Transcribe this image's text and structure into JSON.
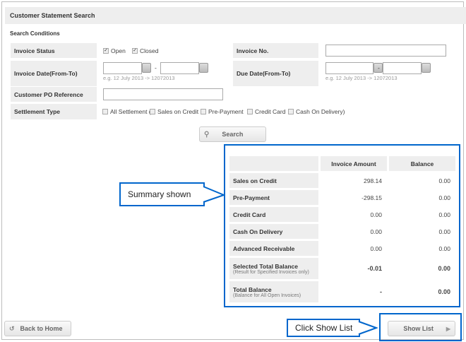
{
  "title": "Customer Statement Search",
  "section": "Search Conditions",
  "fields": {
    "invoice_status": {
      "label": "Invoice Status",
      "options": [
        {
          "label": "Open",
          "checked": true
        },
        {
          "label": "Closed",
          "checked": true
        }
      ]
    },
    "invoice_date": {
      "label": "Invoice Date(From-To)",
      "from": "",
      "to": "",
      "separator": "-",
      "hint": "e.g. 12 July 2013 -> 12072013"
    },
    "invoice_no": {
      "label": "Invoice No.",
      "value": ""
    },
    "due_date": {
      "label": "Due Date(From-To)",
      "from": "",
      "to": "",
      "separator": "-",
      "hint": "e.g. 12 July 2013 -> 12072013"
    },
    "customer_po": {
      "label": "Customer PO Reference",
      "value": ""
    },
    "settlement_type": {
      "label": "Settlement Type",
      "options": [
        "All Settlement (",
        "Sales on Credit",
        "Pre-Payment",
        "Credit Card",
        "Cash On Delivery)"
      ]
    }
  },
  "search_label": "Search",
  "summary": {
    "headers": [
      "",
      "Invoice Amount",
      "Balance"
    ],
    "rows": [
      {
        "label": "Sales on Credit",
        "amount": "298.14",
        "balance": "0.00"
      },
      {
        "label": "Pre-Payment",
        "amount": "-298.15",
        "balance": "0.00"
      },
      {
        "label": "Credit Card",
        "amount": "0.00",
        "balance": "0.00"
      },
      {
        "label": "Cash On Delivery",
        "amount": "0.00",
        "balance": "0.00"
      },
      {
        "label": "Advanced Receivable",
        "amount": "0.00",
        "balance": "0.00"
      },
      {
        "label": "Selected Total Balance",
        "note": "(Result for Specified Invoices only)",
        "amount": "-0.01",
        "balance": "0.00"
      },
      {
        "label": "Total Balance",
        "note": "(Balance for All Open Invoices)",
        "amount": "-",
        "balance": "0.00"
      }
    ]
  },
  "back_label": "Back to Home",
  "show_list_label": "Show List",
  "callouts": {
    "summary": "Summary shown",
    "show_list": "Click Show List"
  },
  "colors": {
    "accent": "#0066cc",
    "label_bg": "#eeeeee"
  }
}
